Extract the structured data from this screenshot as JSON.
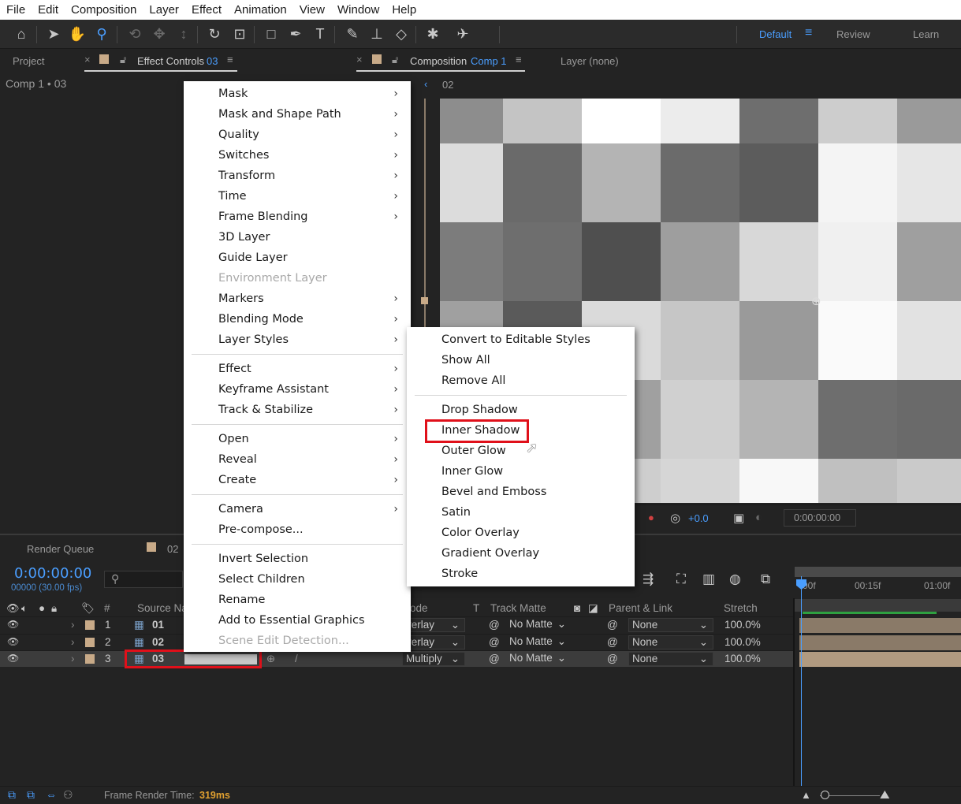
{
  "menubar": [
    "File",
    "Edit",
    "Composition",
    "Layer",
    "Effect",
    "Animation",
    "View",
    "Window",
    "Help"
  ],
  "workspaces": {
    "default": "Default",
    "review": "Review",
    "learn": "Learn"
  },
  "left_panel": {
    "project_tab": "Project",
    "effect_controls_label": "Effect Controls",
    "effect_controls_layer": "03",
    "breadcrumb": "Comp 1 • 03"
  },
  "comp_panel": {
    "tab_label": "Composition",
    "tab_comp": "Comp 1",
    "layer_tab": "Layer (none)",
    "nav_label": "02",
    "exposure": "+0.0",
    "timecode": "0:00:00:00"
  },
  "timeline": {
    "render_queue": "Render Queue",
    "comp_tab": "02",
    "timecode": "0:00:00:00",
    "frame_info": "00000 (30.00 fps)",
    "ruler": [
      "00f",
      "00:15f",
      "01:00f"
    ],
    "headers": {
      "num": "#",
      "source_name": "Source Na",
      "mode": "ode",
      "t": "T",
      "track_matte": "Track Matte",
      "parent": "Parent & Link",
      "stretch": "Stretch"
    },
    "layers": [
      {
        "num": "1",
        "name": "01",
        "mode": "verlay",
        "matte": "No Matte",
        "parent": "None",
        "stretch": "100.0%"
      },
      {
        "num": "2",
        "name": "02",
        "mode": "verlay",
        "matte": "No Matte",
        "parent": "None",
        "stretch": "100.0%"
      },
      {
        "num": "3",
        "name": "03",
        "mode": "Multiply",
        "matte": "No Matte",
        "parent": "None",
        "stretch": "100.0%"
      }
    ],
    "status_label": "Frame Render Time:",
    "status_value": "319ms"
  },
  "context_menu": {
    "items": [
      {
        "label": "Mask",
        "submenu": true
      },
      {
        "label": "Mask and Shape Path",
        "submenu": true
      },
      {
        "label": "Quality",
        "submenu": true
      },
      {
        "label": "Switches",
        "submenu": true
      },
      {
        "label": "Transform",
        "submenu": true
      },
      {
        "label": "Time",
        "submenu": true
      },
      {
        "label": "Frame Blending",
        "submenu": true
      },
      {
        "label": "3D Layer"
      },
      {
        "label": "Guide Layer"
      },
      {
        "label": "Environment Layer",
        "disabled": true
      },
      {
        "label": "Markers",
        "submenu": true
      },
      {
        "label": "Blending Mode",
        "submenu": true
      },
      {
        "label": "Layer Styles",
        "submenu": true
      },
      {
        "label": "Effect",
        "submenu": true
      },
      {
        "label": "Keyframe Assistant",
        "submenu": true
      },
      {
        "label": "Track & Stabilize",
        "submenu": true
      },
      {
        "label": "Open",
        "submenu": true
      },
      {
        "label": "Reveal",
        "submenu": true
      },
      {
        "label": "Create",
        "submenu": true
      },
      {
        "label": "Camera",
        "submenu": true
      },
      {
        "label": "Pre-compose..."
      },
      {
        "label": "Invert Selection"
      },
      {
        "label": "Select Children"
      },
      {
        "label": "Rename"
      },
      {
        "label": "Add to Essential Graphics"
      },
      {
        "label": "Scene Edit Detection...",
        "disabled": true
      }
    ]
  },
  "submenu_layer_styles": {
    "items": [
      "Convert to Editable Styles",
      "Show All",
      "Remove All",
      "Drop Shadow",
      "Inner Shadow",
      "Outer Glow",
      "Inner Glow",
      "Bevel and Emboss",
      "Satin",
      "Color Overlay",
      "Gradient Overlay",
      "Stroke"
    ],
    "highlighted": "Inner Shadow"
  },
  "colors": {
    "accent": "#4a9eff",
    "highlight_box": "#e0101a",
    "layer_label": "#c8aa88"
  },
  "icons": [
    "home-icon",
    "selection-arrow-icon",
    "hand-icon",
    "zoom-icon",
    "rotate-icon",
    "pen-icon",
    "text-icon",
    "brush-icon",
    "stamp-icon",
    "eraser-icon",
    "puppet-icon",
    "pin-icon",
    "eye-icon",
    "audio-icon",
    "lock-icon",
    "label-icon"
  ]
}
